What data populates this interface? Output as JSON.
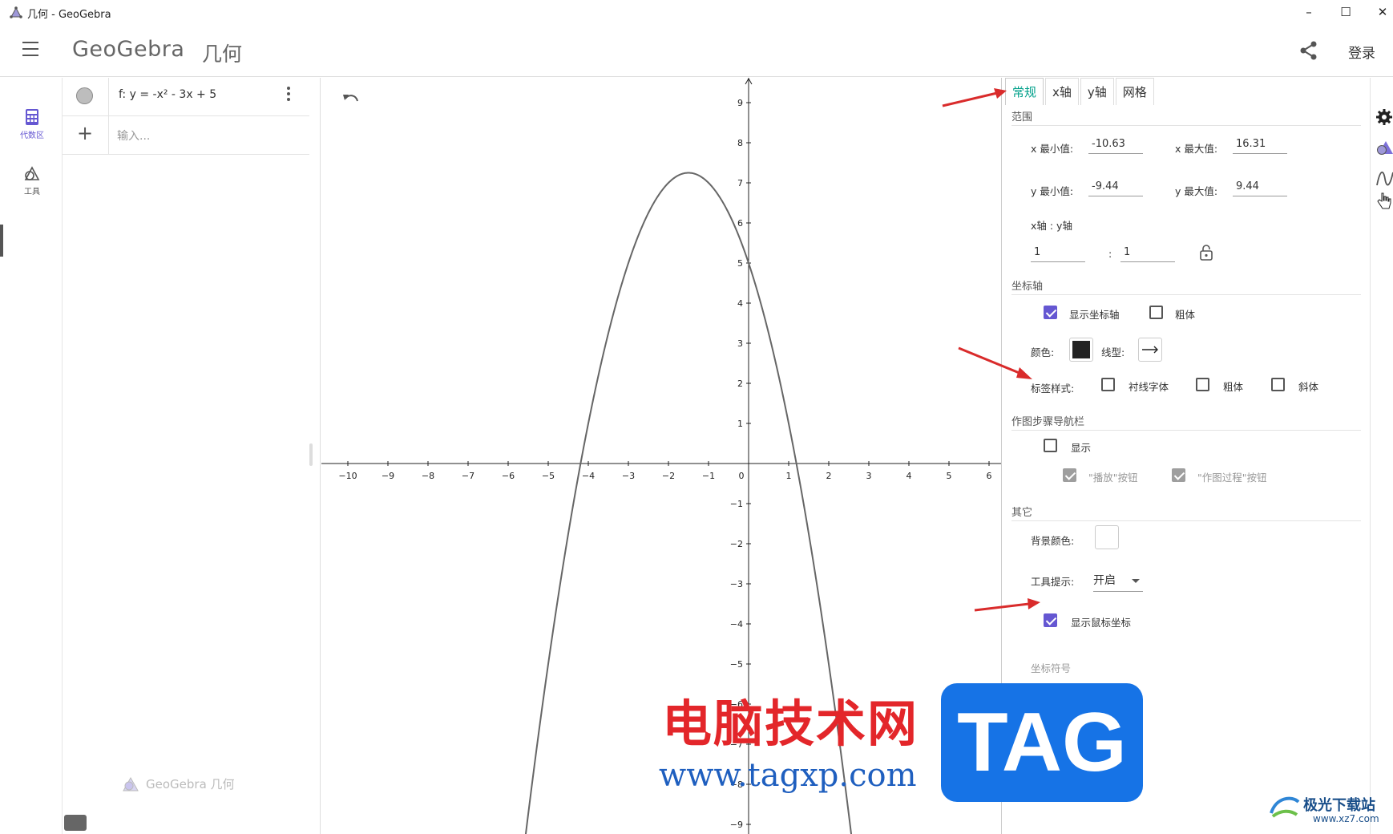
{
  "window": {
    "title": "几何 - GeoGebra",
    "minimize": "–",
    "maximize": "☐",
    "close": "✕"
  },
  "header": {
    "brand": "GeoGebra",
    "app_name": "几何",
    "login": "登录"
  },
  "navrail": {
    "items": [
      {
        "label": "代数区",
        "icon": "calculator-icon"
      },
      {
        "label": "工具",
        "icon": "shapes-icon"
      }
    ]
  },
  "algebra": {
    "rows": [
      {
        "expression": "f: y = -x² - 3x + 5"
      }
    ],
    "input_placeholder": "输入...",
    "watermark": "GeoGebra 几何"
  },
  "graph": {
    "x_ticks": [
      "−10",
      "−9",
      "−8",
      "−7",
      "−6",
      "−5",
      "−4",
      "−3",
      "−2",
      "−1",
      "0",
      "1",
      "2",
      "3",
      "4",
      "5",
      "6"
    ],
    "y_ticks": [
      "9",
      "8",
      "7",
      "6",
      "5",
      "4",
      "3",
      "2",
      "1",
      "−1",
      "−2",
      "−3",
      "−4",
      "−5",
      "−6",
      "−7",
      "−8",
      "−9"
    ],
    "function": "y = -x^2 - 3x + 5",
    "curve_color": "#666666"
  },
  "settings": {
    "tabs": [
      "常规",
      "x轴",
      "y轴",
      "网格"
    ],
    "active_tab": "常规",
    "range": {
      "section": "范围",
      "xmin_label": "x 最小值:",
      "xmin": "-10.63",
      "xmax_label": "x 最大值:",
      "xmax": "16.31",
      "ymin_label": "y 最小值:",
      "ymin": "-9.44",
      "ymax_label": "y 最大值:",
      "ymax": "9.44",
      "ratio_label": "x轴 : y轴",
      "ratio_x": "1",
      "ratio_sep": ":",
      "ratio_y": "1"
    },
    "axes": {
      "section": "坐标轴",
      "show_axes": "显示坐标轴",
      "bold": "粗体",
      "color_label": "颜色:",
      "linestyle_label": "线型:",
      "label_style": "标签样式:",
      "serif": "衬线字体",
      "bold2": "粗体",
      "italic": "斜体",
      "axis_color": "#222222"
    },
    "nav": {
      "section": "作图步骤导航栏",
      "show": "显示",
      "play_button": "\"播放\"按钮",
      "construction_button": "\"作图过程\"按钮"
    },
    "other": {
      "section": "其它",
      "bg_color_label": "背景颜色:",
      "tooltips_label": "工具提示:",
      "tooltips_value": "开启",
      "show_mouse_coords": "显示鼠标坐标",
      "faint_label": "坐标符号"
    },
    "accent_color": "#00a08a",
    "check_color": "#6557d2"
  },
  "watermarks": {
    "cn": "电脑技术网",
    "url": "www.tagxp.com",
    "tag": "TAG",
    "site": "极光下载站",
    "site_url": "www.xz7.com"
  }
}
